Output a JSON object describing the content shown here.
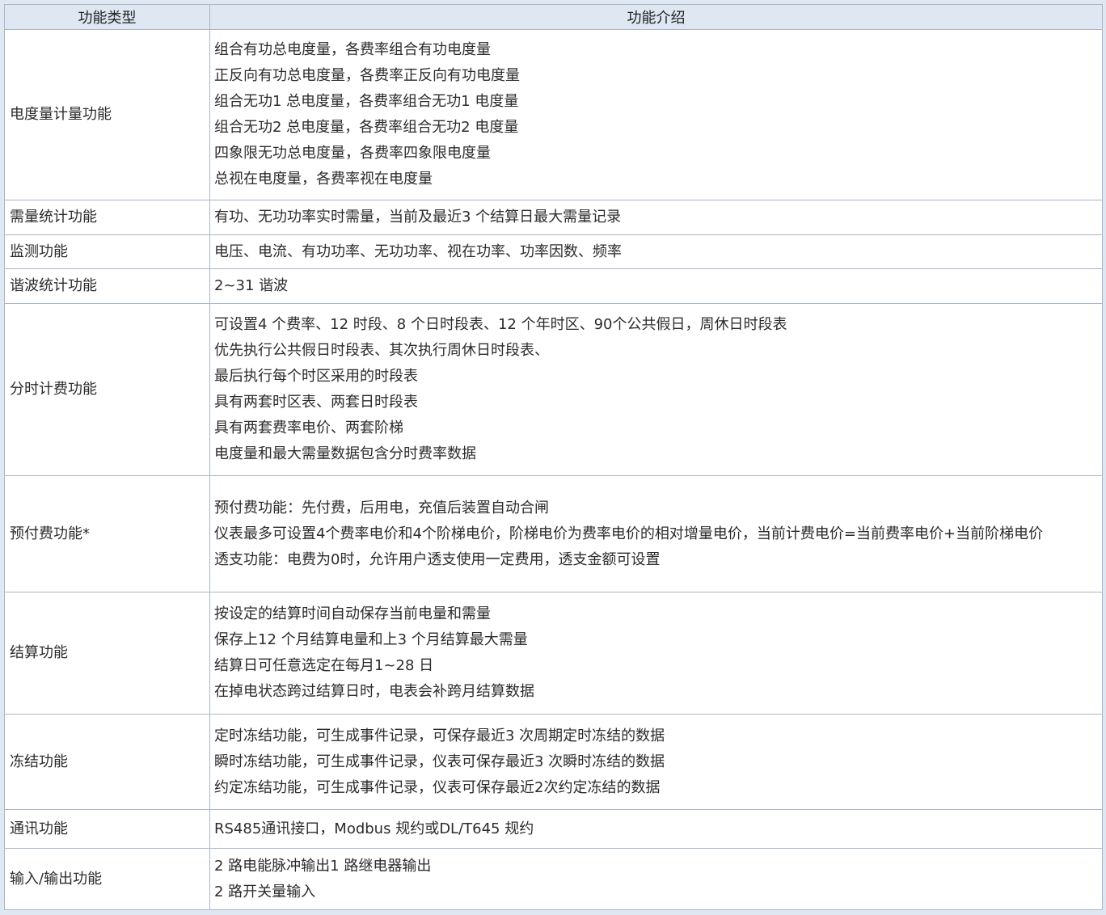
{
  "table": {
    "headers": [
      "功能类型",
      "功能介绍"
    ],
    "rows": [
      {
        "type": "电度量计量功能",
        "lines": [
          "组合有功总电度量，各费率组合有功电度量",
          "正反向有功总电度量，各费率正反向有功电度量",
          "组合无功1 总电度量，各费率组合无功1 电度量",
          "组合无功2 总电度量，各费率组合无功2 电度量",
          "四象限无功总电度量，各费率四象限电度量",
          "总视在电度量，各费率视在电度量"
        ]
      },
      {
        "type": "需量统计功能",
        "lines": [
          "有功、无功功率实时需量，当前及最近3 个结算日最大需量记录"
        ]
      },
      {
        "type": "监测功能",
        "lines": [
          "电压、电流、有功功率、无功功率、视在功率、功率因数、频率"
        ]
      },
      {
        "type": "谐波统计功能",
        "lines": [
          "2~31 谐波"
        ]
      },
      {
        "type": "分时计费功能",
        "lines": [
          "可设置4 个费率、12 时段、8 个日时段表、12 个年时区、90个公共假日，周休日时段表",
          "优先执行公共假日时段表、其次执行周休日时段表、",
          "最后执行每个时区采用的时段表",
          "具有两套时区表、两套日时段表",
          "具有两套费率电价、两套阶梯",
          "电度量和最大需量数据包含分时费率数据"
        ]
      },
      {
        "type": "预付费功能*",
        "lines": [
          "预付费功能：先付费，后用电，充值后装置自动合闸",
          "仪表最多可设置4个费率电价和4个阶梯电价，阶梯电价为费率电价的相对增量电价，当前计费电价=当前费率电价+当前阶梯电价",
          "透支功能：电费为0时，允许用户透支使用一定费用，透支金额可设置"
        ]
      },
      {
        "type": "结算功能",
        "lines": [
          "按设定的结算时间自动保存当前电量和需量",
          "保存上12 个月结算电量和上3 个月结算最大需量",
          "结算日可任意选定在每月1~28 日",
          "在掉电状态跨过结算日时，电表会补跨月结算数据"
        ]
      },
      {
        "type": "冻结功能",
        "lines": [
          "定时冻结功能，可生成事件记录，可保存最近3 次周期定时冻结的数据",
          "瞬时冻结功能，可生成事件记录，仪表可保存最近3 次瞬时冻结的数据",
          "约定冻结功能，可生成事件记录，仪表可保存最近2次约定冻结的数据"
        ]
      },
      {
        "type": "通讯功能",
        "lines": [
          "RS485通讯接口，Modbus 规约或DL/T645 规约"
        ]
      },
      {
        "type": "输入/输出功能",
        "lines": [
          "2 路电能脉冲输出1 路继电器输出",
          "2 路开关量输入"
        ]
      }
    ]
  }
}
